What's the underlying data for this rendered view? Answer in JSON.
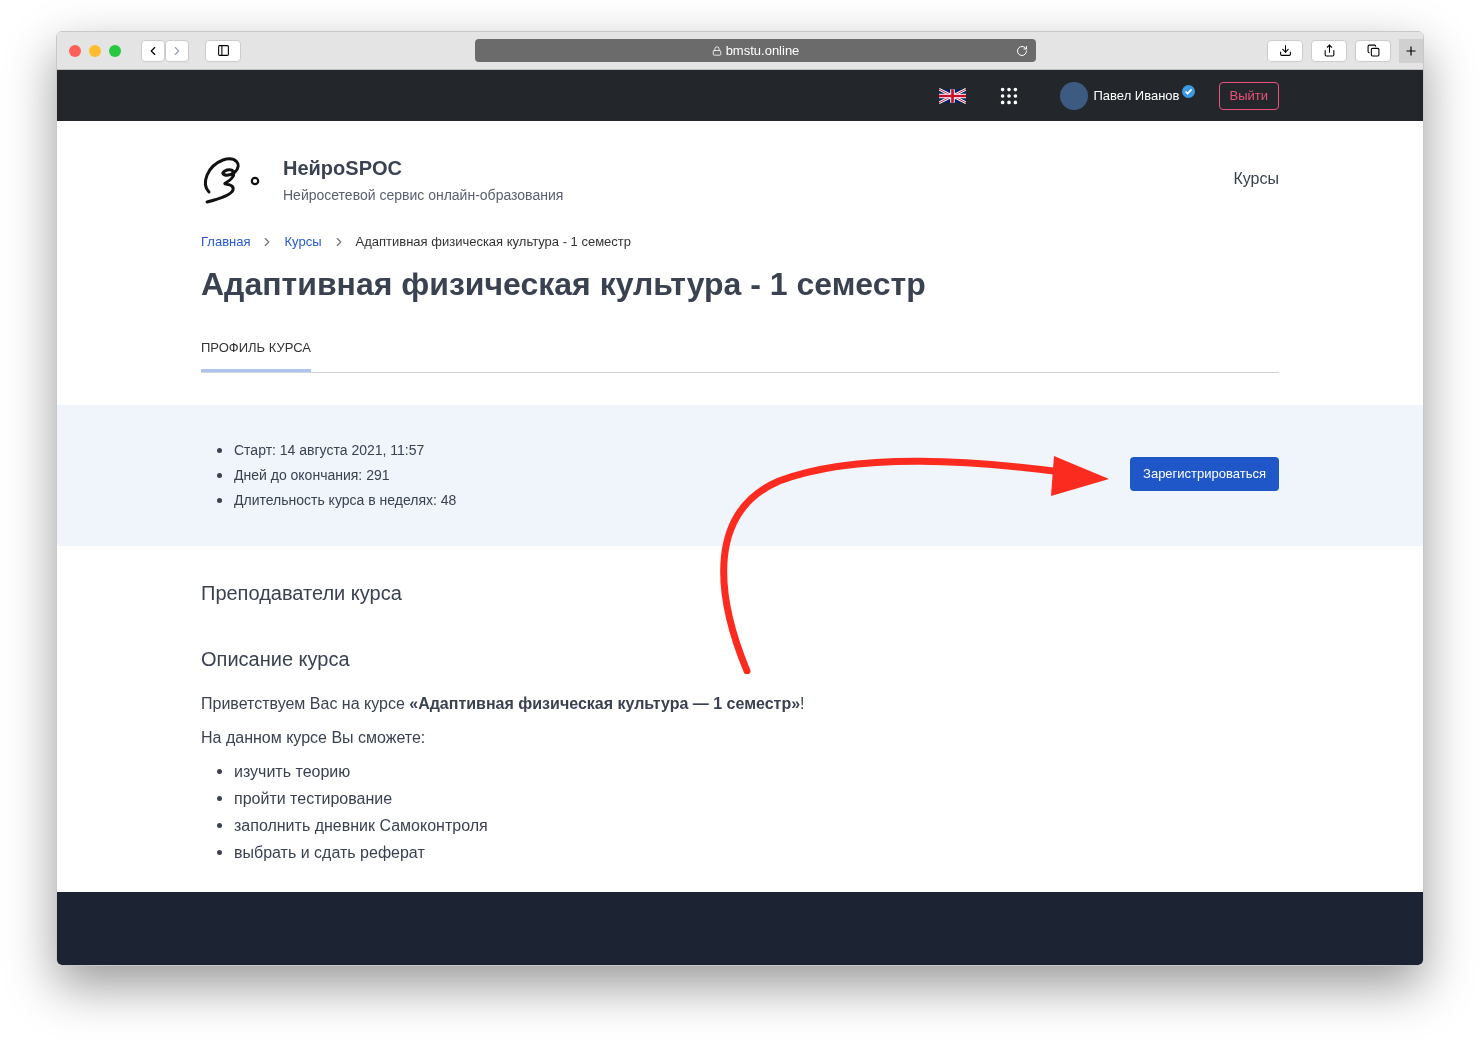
{
  "browser": {
    "url": "bmstu.online"
  },
  "topbar": {
    "user_name": "Павел Иванов",
    "verified": true,
    "logout": "Выйти"
  },
  "header": {
    "brand": "НейроSPOC",
    "tagline": "Нейросетевой сервис онлайн-образования",
    "nav": [
      "Курсы"
    ]
  },
  "breadcrumbs": [
    {
      "label": "Главная",
      "kind": "link"
    },
    {
      "label": "Курсы",
      "kind": "link"
    },
    {
      "label": "Адаптивная физическая культура - 1 семестр",
      "kind": "current"
    }
  ],
  "title": "Адаптивная физическая культура - 1 семестр",
  "tabs": [
    {
      "label": "ПРОФИЛЬ КУРСА",
      "selected": true
    }
  ],
  "info": {
    "items": [
      "Старт: 14 августа 2021, 11:57",
      "Дней до окончания: 291",
      "Длительность курса в неделях: 48"
    ],
    "register": "Зарегистрироваться"
  },
  "sections": [
    {
      "heading": "Преподаватели курса"
    },
    {
      "heading": "Описание курса"
    }
  ],
  "description": {
    "paragraphs": [
      "Приветствуем Вас на курсе **«Адаптивная физическая культура — 1 семестр»**!",
      "На данном курсе Вы сможете:"
    ],
    "items": [
      "изучить теорию",
      "пройти тестирование",
      "заполнить дневник Самоконтроля",
      "выбрать и сдать реферат"
    ]
  }
}
